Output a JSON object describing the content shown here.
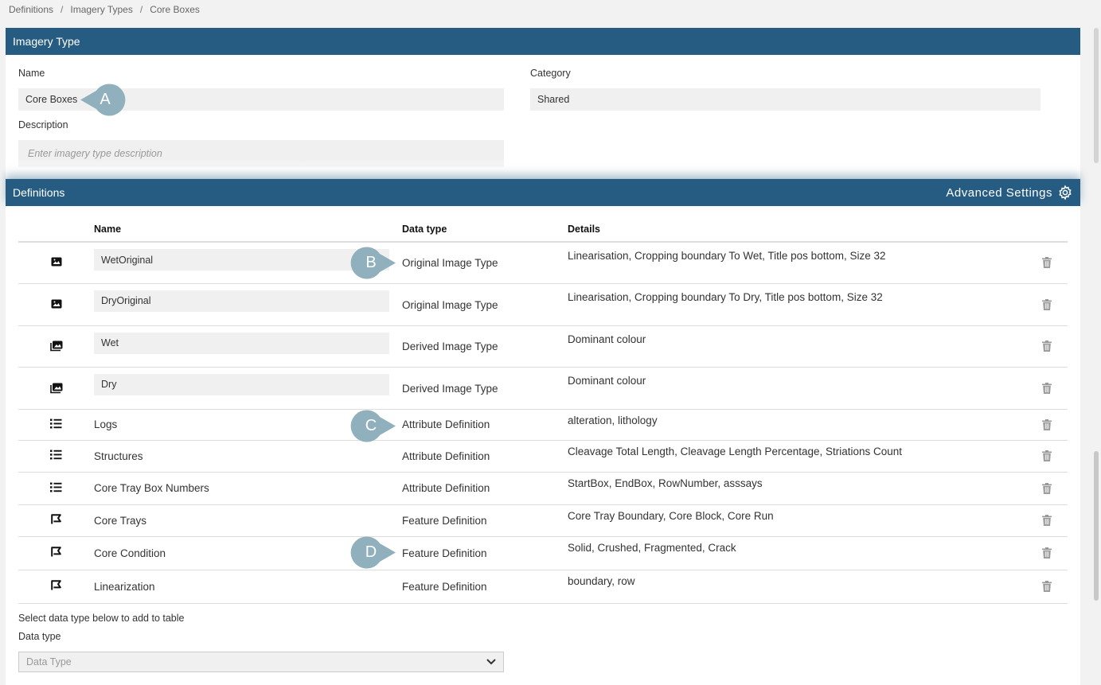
{
  "breadcrumb": [
    "Definitions",
    "Imagery Types",
    "Core Boxes"
  ],
  "breadcrumb_sep": "/",
  "imagery_panel": {
    "title": "Imagery Type",
    "name_label": "Name",
    "name_value": "Core Boxes",
    "category_label": "Category",
    "category_value": "Shared",
    "description_label": "Description",
    "description_placeholder": "Enter imagery type description"
  },
  "definitions_panel": {
    "title": "Definitions",
    "advanced_settings": "Advanced Settings",
    "columns": {
      "name": "Name",
      "data_type": "Data type",
      "details": "Details"
    },
    "rows": [
      {
        "icon": "image-icon",
        "name": "WetOriginal",
        "editable": true,
        "data_type": "Original Image Type",
        "details": "Linearisation, Cropping boundary To Wet, Title pos bottom, Size 32"
      },
      {
        "icon": "image-icon",
        "name": "DryOriginal",
        "editable": true,
        "data_type": "Original Image Type",
        "details": "Linearisation, Cropping boundary To Dry, Title pos bottom, Size 32"
      },
      {
        "icon": "images-icon",
        "name": "Wet",
        "editable": true,
        "data_type": "Derived Image Type",
        "details": "Dominant colour"
      },
      {
        "icon": "images-icon",
        "name": "Dry",
        "editable": true,
        "data_type": "Derived Image Type",
        "details": "Dominant colour"
      },
      {
        "icon": "list-icon",
        "name": "Logs",
        "editable": false,
        "data_type": "Attribute Definition",
        "details": "alteration, lithology"
      },
      {
        "icon": "list-icon",
        "name": "Structures",
        "editable": false,
        "data_type": "Attribute Definition",
        "details": "Cleavage Total Length, Cleavage Length Percentage, Striations Count"
      },
      {
        "icon": "list-icon",
        "name": "Core Tray Box Numbers",
        "editable": false,
        "data_type": "Attribute Definition",
        "details": "StartBox, EndBox, RowNumber, asssays"
      },
      {
        "icon": "feature-icon",
        "name": "Core Trays",
        "editable": false,
        "data_type": "Feature Definition",
        "details": "Core Tray Boundary, Core Block, Core Run"
      },
      {
        "icon": "feature-icon",
        "name": "Core Condition",
        "editable": false,
        "data_type": "Feature Definition",
        "details": "Solid, Crushed, Fragmented, Crack"
      },
      {
        "icon": "feature-icon",
        "name": "Linearization",
        "editable": false,
        "data_type": "Feature Definition",
        "details": "boundary, row"
      }
    ],
    "add_hint": "Select data type below to add to table",
    "data_type_label": "Data type",
    "data_type_placeholder": "Data Type"
  },
  "callouts": [
    "A",
    "B",
    "C",
    "D"
  ],
  "colors": {
    "header": "#265c82",
    "callout": "#8fb0bc",
    "input_bg": "#f0f0f0"
  }
}
